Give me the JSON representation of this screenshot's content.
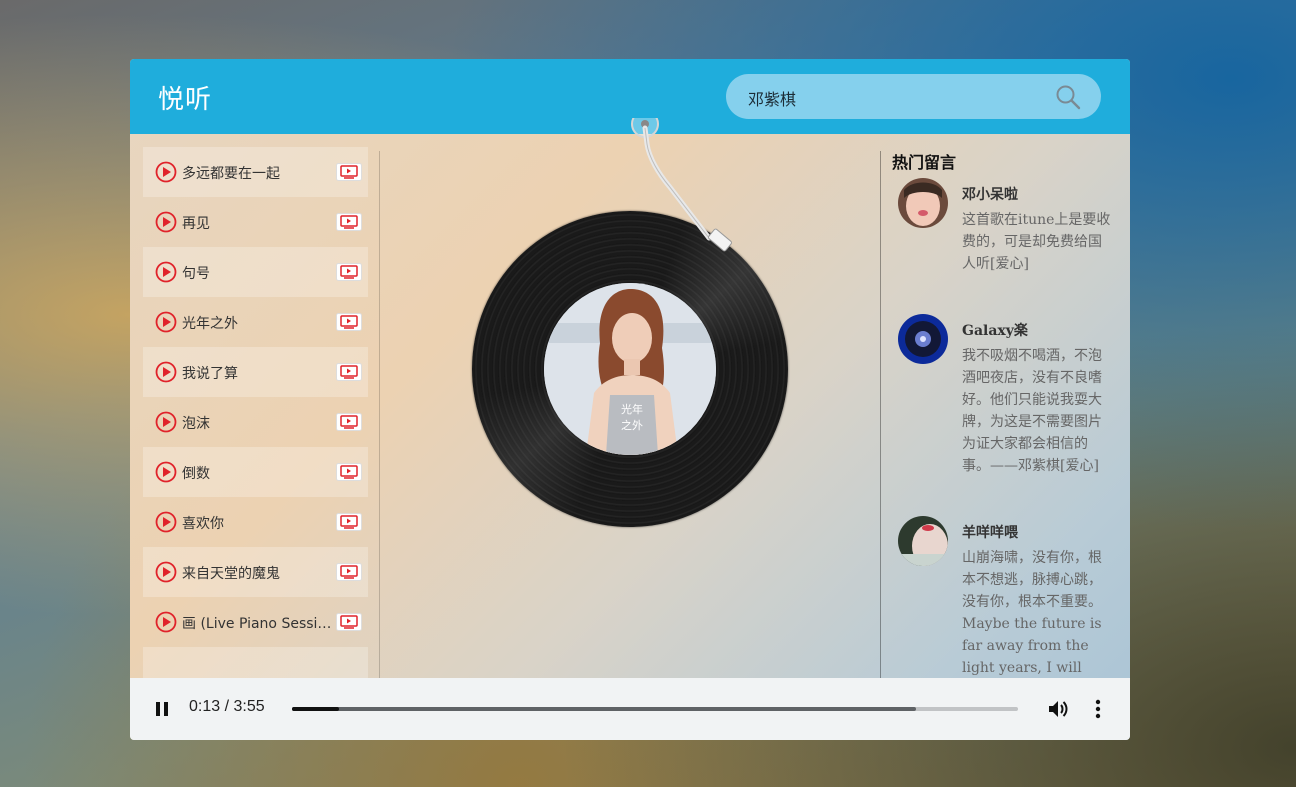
{
  "app": {
    "logo": "悦听"
  },
  "search": {
    "value": "邓紫棋"
  },
  "playlist": [
    {
      "title": "多远都要在一起"
    },
    {
      "title": "再见"
    },
    {
      "title": "句号"
    },
    {
      "title": "光年之外"
    },
    {
      "title": "我说了算"
    },
    {
      "title": "泡沫"
    },
    {
      "title": "倒数"
    },
    {
      "title": "喜欢你"
    },
    {
      "title": "来自天堂的魔鬼"
    },
    {
      "title": "画 (Live Piano Session II)"
    }
  ],
  "cover": {
    "text": "光年之外"
  },
  "comments": {
    "title": "热门留言",
    "items": [
      {
        "user": "邓小呆啦",
        "text": "这首歌在itune上是要收费的，可是却免费给国人听[爱心]"
      },
      {
        "user": "Galaxy楽",
        "text": "我不吸烟不喝酒，不泡酒吧夜店，没有不良嗜好。他们只能说我耍大牌，为这是不需要图片为证大家都会相信的事。——邓紫棋[爱心]"
      },
      {
        "user": "羊咩咩喂",
        "text": "山崩海啸，没有你，根本不想逃，脉搏心跳，没有你，根本不重要。Maybe the future is far away from the light years, I will wait for you"
      }
    ]
  },
  "player": {
    "time": "0:13 / 3:55",
    "played_fraction": 0.065,
    "buffered_fraction": 0.86
  },
  "colors": {
    "header": "#1faddc",
    "accent_red": "#e0222a"
  }
}
